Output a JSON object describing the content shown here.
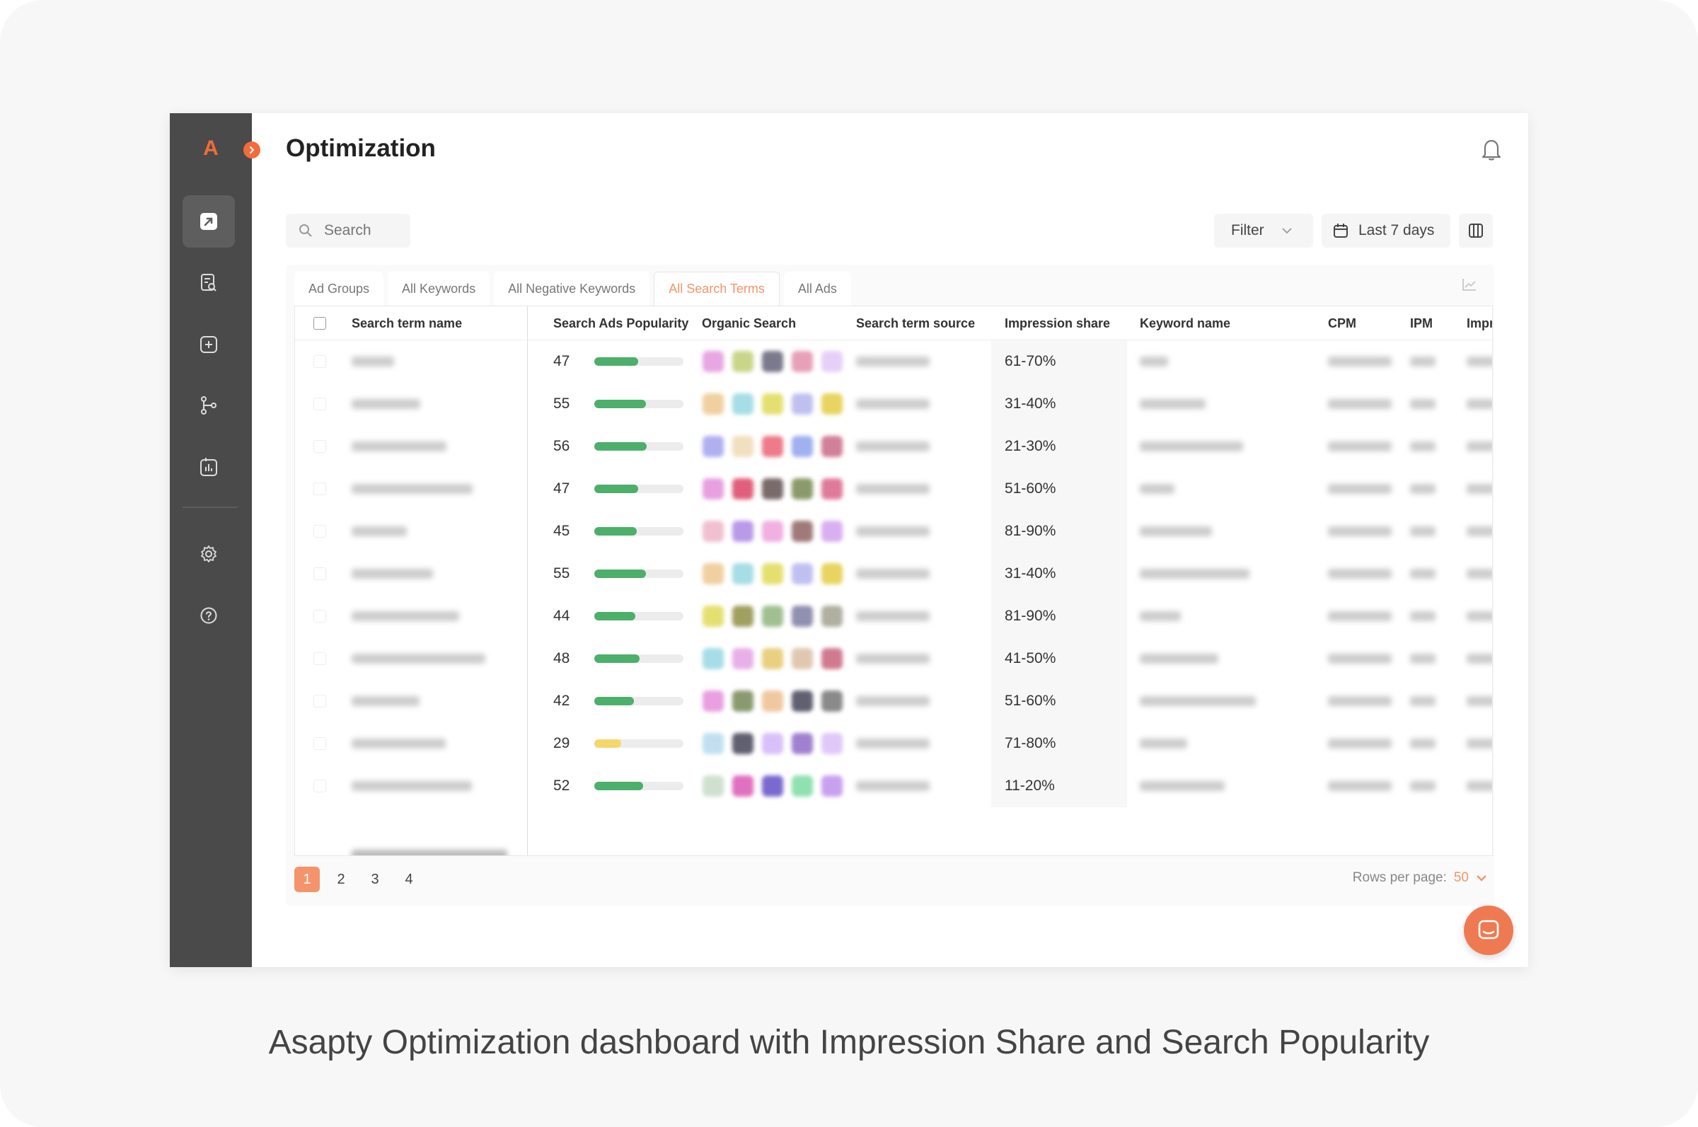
{
  "app": {
    "logo": "A",
    "title": "Optimization"
  },
  "sidebar": {
    "items": [
      {
        "icon": "dashboard-arrow-icon",
        "active": true
      },
      {
        "icon": "document-search-icon",
        "active": false
      },
      {
        "icon": "add-square-icon",
        "active": false
      },
      {
        "icon": "flow-icon",
        "active": false
      },
      {
        "icon": "report-chart-icon",
        "active": false
      },
      {
        "icon": "gear-icon",
        "active": false
      },
      {
        "icon": "help-icon",
        "active": false
      }
    ]
  },
  "toolbar": {
    "search_placeholder": "Search",
    "filter_label": "Filter",
    "date_label": "Last 7 days"
  },
  "tabs": [
    {
      "label": "Ad Groups",
      "active": false
    },
    {
      "label": "All Keywords",
      "active": false
    },
    {
      "label": "All Negative Keywords",
      "active": false
    },
    {
      "label": "All Search Terms",
      "active": true
    },
    {
      "label": "All Ads",
      "active": false
    }
  ],
  "table": {
    "columns": {
      "name": "Search term name",
      "popularity": "Search Ads Popularity",
      "organic": "Organic Search",
      "source": "Search term source",
      "impression": "Impression share",
      "keyword": "Keyword name",
      "cpm": "CPM",
      "ipm": "IPM",
      "impr": "Impr"
    },
    "rows": [
      {
        "popularity": "47",
        "pop_value": 47,
        "impression": "61-70%"
      },
      {
        "popularity": "55",
        "pop_value": 55,
        "impression": "31-40%"
      },
      {
        "popularity": "56",
        "pop_value": 56,
        "impression": "21-30%"
      },
      {
        "popularity": "47",
        "pop_value": 47,
        "impression": "51-60%"
      },
      {
        "popularity": "45",
        "pop_value": 45,
        "impression": "81-90%"
      },
      {
        "popularity": "55",
        "pop_value": 55,
        "impression": "31-40%"
      },
      {
        "popularity": "44",
        "pop_value": 44,
        "impression": "81-90%"
      },
      {
        "popularity": "48",
        "pop_value": 48,
        "impression": "41-50%"
      },
      {
        "popularity": "42",
        "pop_value": 42,
        "impression": "51-60%"
      },
      {
        "popularity": "29",
        "pop_value": 29,
        "impression": "71-80%"
      },
      {
        "popularity": "52",
        "pop_value": 52,
        "impression": "11-20%"
      }
    ]
  },
  "pagination": {
    "pages": [
      "1",
      "2",
      "3",
      "4"
    ],
    "current": "1",
    "rows_per_page_label": "Rows per page:",
    "rows_per_page_value": "50"
  },
  "caption": "Asapty Optimization dashboard with Impression Share and Search Popularity",
  "colors": {
    "accent": "#f26b3a",
    "bar_green": "#4caf6a",
    "bar_yellow": "#f5d76e"
  }
}
